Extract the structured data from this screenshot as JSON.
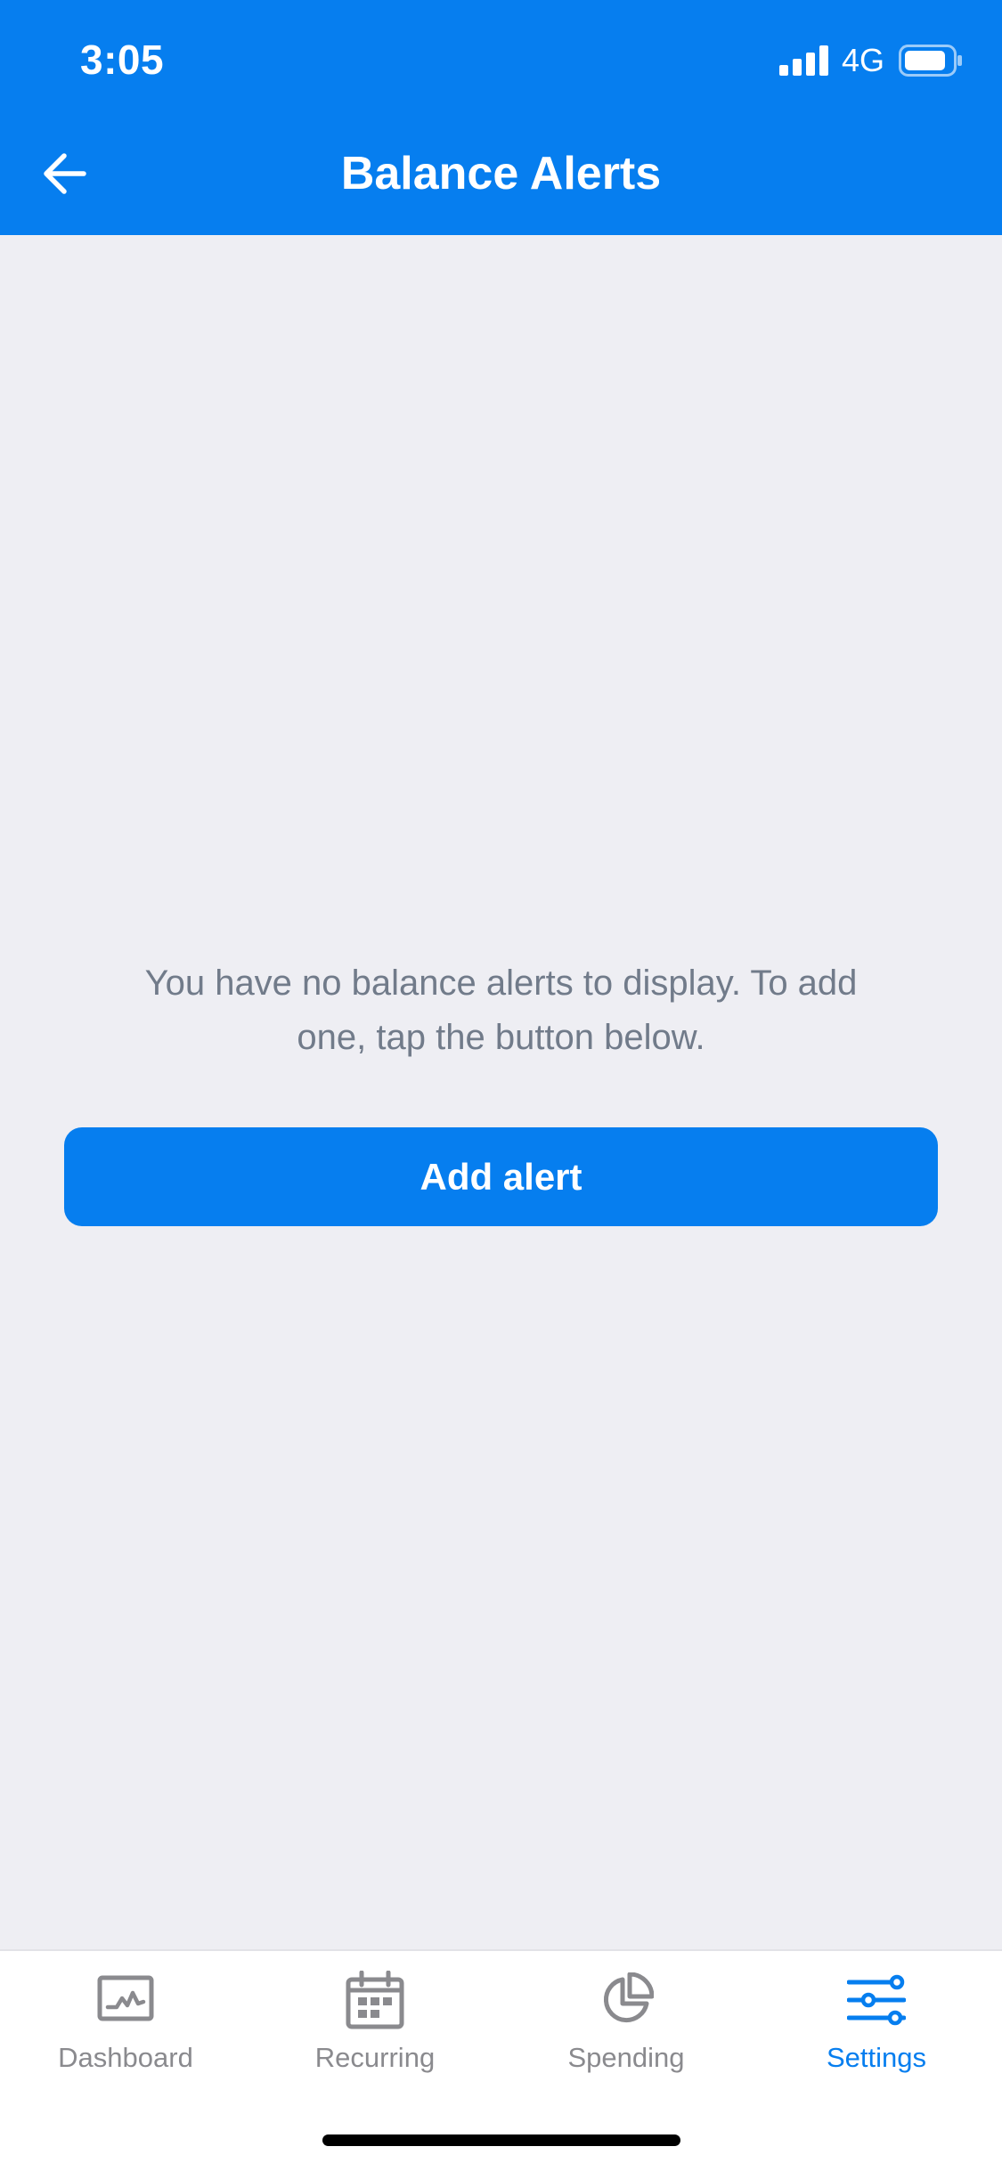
{
  "status_bar": {
    "time": "3:05",
    "network": "4G",
    "icons": [
      "signal-icon",
      "battery-icon"
    ]
  },
  "header": {
    "title": "Balance Alerts",
    "back_icon": "arrow-left-icon"
  },
  "empty_state": {
    "message": "You have no balance alerts to display. To add one, tap the button below.",
    "button_label": "Add alert"
  },
  "tab_bar": {
    "tabs": [
      {
        "label": "Dashboard",
        "icon": "dashboard-chart-icon",
        "active": false
      },
      {
        "label": "Recurring",
        "icon": "calendar-icon",
        "active": false
      },
      {
        "label": "Spending",
        "icon": "pie-chart-icon",
        "active": false
      },
      {
        "label": "Settings",
        "icon": "sliders-icon",
        "active": true
      }
    ]
  },
  "colors": {
    "accent": "#067EEF",
    "background": "#EEEEF3",
    "muted_text": "#717B8A",
    "inactive_tab": "#8A8A8E"
  }
}
